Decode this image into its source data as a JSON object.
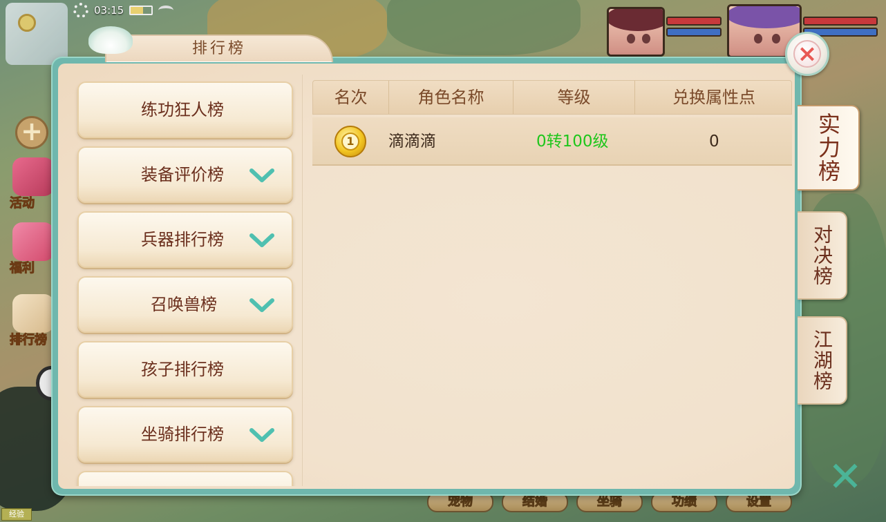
{
  "status_bar": {
    "time": "03:15"
  },
  "background": {
    "side_menu": [
      {
        "label": "活动",
        "icon": "activity-icon"
      },
      {
        "label": "福利",
        "icon": "gift-icon"
      },
      {
        "label": "排行榜",
        "icon": "ranking-icon"
      }
    ],
    "exp_label": "经验",
    "bottom_buttons": [
      "宠物",
      "结婚",
      "坐骑",
      "功绩",
      "设置"
    ]
  },
  "dialog": {
    "title": "排行榜",
    "close_label": "×",
    "categories": [
      {
        "label": "练功狂人榜",
        "expandable": false
      },
      {
        "label": "装备评价榜",
        "expandable": true
      },
      {
        "label": "兵器排行榜",
        "expandable": true
      },
      {
        "label": "召唤兽榜",
        "expandable": true
      },
      {
        "label": "孩子排行榜",
        "expandable": false
      },
      {
        "label": "坐骑排行榜",
        "expandable": true
      }
    ],
    "table": {
      "columns": [
        "名次",
        "角色名称",
        "等级",
        "兑换属性点"
      ],
      "rows": [
        {
          "rank": "1",
          "name": "滴滴滴",
          "level": "0转100级",
          "points": "0"
        }
      ]
    },
    "tabs": [
      {
        "label": "实力榜",
        "active": true
      },
      {
        "label": "对决榜",
        "active": false
      },
      {
        "label": "江湖榜",
        "active": false
      }
    ]
  },
  "colors": {
    "accent_teal": "#6fb7ad",
    "level_green": "#1fc61c",
    "title_brown": "#7a4a2a"
  }
}
